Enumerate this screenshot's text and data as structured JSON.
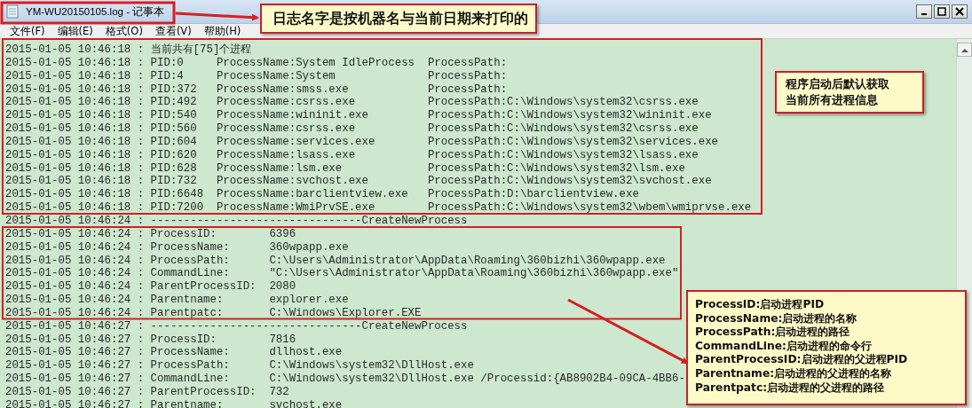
{
  "window": {
    "title": "YM-WU20150105.log - 记事本"
  },
  "menu": [
    "文件(F)",
    "编辑(E)",
    "格式(O)",
    "查看(V)",
    "帮助(H)"
  ],
  "lines": [
    {
      "kind": "note",
      "cells": [
        "2015-01-05 10:46:18 :",
        "当前共有[75]个进程"
      ]
    },
    {
      "kind": "process",
      "cells": [
        "2015-01-05 10:46:18 :",
        "PID:0",
        "ProcessName:System IdleProcess",
        "ProcessPath:"
      ]
    },
    {
      "kind": "process",
      "cells": [
        "2015-01-05 10:46:18 :",
        "PID:4",
        "ProcessName:System",
        "ProcessPath:"
      ]
    },
    {
      "kind": "process",
      "cells": [
        "2015-01-05 10:46:18 :",
        "PID:372",
        "ProcessName:smss.exe",
        "ProcessPath:"
      ]
    },
    {
      "kind": "process",
      "cells": [
        "2015-01-05 10:46:18 :",
        "PID:492",
        "ProcessName:csrss.exe",
        "ProcessPath:C:\\Windows\\system32\\csrss.exe"
      ]
    },
    {
      "kind": "process",
      "cells": [
        "2015-01-05 10:46:18 :",
        "PID:540",
        "ProcessName:wininit.exe",
        "ProcessPath:C:\\Windows\\system32\\wininit.exe"
      ]
    },
    {
      "kind": "process",
      "cells": [
        "2015-01-05 10:46:18 :",
        "PID:560",
        "ProcessName:csrss.exe",
        "ProcessPath:C:\\Windows\\system32\\csrss.exe"
      ]
    },
    {
      "kind": "process",
      "cells": [
        "2015-01-05 10:46:18 :",
        "PID:604",
        "ProcessName:services.exe",
        "ProcessPath:C:\\Windows\\system32\\services.exe"
      ]
    },
    {
      "kind": "process",
      "cells": [
        "2015-01-05 10:46:18 :",
        "PID:620",
        "ProcessName:lsass.exe",
        "ProcessPath:C:\\Windows\\system32\\lsass.exe"
      ]
    },
    {
      "kind": "process",
      "cells": [
        "2015-01-05 10:46:18 :",
        "PID:628",
        "ProcessName:lsm.exe",
        "ProcessPath:C:\\Windows\\system32\\lsm.exe"
      ]
    },
    {
      "kind": "process",
      "cells": [
        "2015-01-05 10:46:18 :",
        "PID:732",
        "ProcessName:svchost.exe",
        "ProcessPath:C:\\Windows\\system32\\svchost.exe"
      ]
    },
    {
      "kind": "process",
      "cells": [
        "2015-01-05 10:46:18 :",
        "PID:6648",
        "ProcessName:barclientview.exe",
        "ProcessPath:D:\\barclientview.exe"
      ]
    },
    {
      "kind": "process",
      "cells": [
        "2015-01-05 10:46:18 :",
        "PID:7200",
        "ProcessName:WmiPrvSE.exe",
        "ProcessPath:C:\\Windows\\system32\\wbem\\wmiprvse.exe"
      ]
    },
    {
      "kind": "separator",
      "cells": [
        "2015-01-05 10:46:24 :",
        "--------------------------------CreateNewProcess"
      ]
    },
    {
      "kind": "field",
      "cells": [
        "2015-01-05 10:46:24 :",
        "ProcessID:",
        "6396"
      ]
    },
    {
      "kind": "field",
      "cells": [
        "2015-01-05 10:46:24 :",
        "ProcessName:",
        "360wpapp.exe"
      ]
    },
    {
      "kind": "field",
      "cells": [
        "2015-01-05 10:46:24 :",
        "ProcessPath:",
        "C:\\Users\\Administrator\\AppData\\Roaming\\360bizhi\\360wpapp.exe"
      ]
    },
    {
      "kind": "field",
      "cells": [
        "2015-01-05 10:46:24 :",
        "CommandLine:",
        "\"C:\\Users\\Administrator\\AppData\\Roaming\\360bizhi\\360wpapp.exe\""
      ]
    },
    {
      "kind": "field",
      "cells": [
        "2015-01-05 10:46:24 :",
        "ParentProcessID:",
        "2080"
      ]
    },
    {
      "kind": "field",
      "cells": [
        "2015-01-05 10:46:24 :",
        "Parentname:",
        "explorer.exe"
      ]
    },
    {
      "kind": "field",
      "cells": [
        "2015-01-05 10:46:24 :",
        "Parentpatc:",
        "C:\\Windows\\Explorer.EXE"
      ]
    },
    {
      "kind": "separator",
      "cells": [
        "2015-01-05 10:46:27 :",
        "--------------------------------CreateNewProcess"
      ]
    },
    {
      "kind": "field",
      "cells": [
        "2015-01-05 10:46:27 :",
        "ProcessID:",
        "7816"
      ]
    },
    {
      "kind": "field",
      "cells": [
        "2015-01-05 10:46:27 :",
        "ProcessName:",
        "dllhost.exe"
      ]
    },
    {
      "kind": "field",
      "cells": [
        "2015-01-05 10:46:27 :",
        "ProcessPath:",
        "C:\\Windows\\system32\\DllHost.exe"
      ]
    },
    {
      "kind": "field",
      "cells": [
        "2015-01-05 10:46:27 :",
        "CommandLine:",
        "C:\\Windows\\system32\\DllHost.exe /Processid:{AB8902B4-09CA-4BB6-"
      ]
    },
    {
      "kind": "field",
      "cells": [
        "2015-01-05 10:46:27 :",
        "ParentProcessID:",
        "732"
      ]
    },
    {
      "kind": "field",
      "cells": [
        "2015-01-05 10:46:27 :",
        "Parentname:",
        "svchost.exe"
      ]
    }
  ],
  "callouts": [
    {
      "kind": "title",
      "lines": [
        "日志名字是按机器名与当前日期来打印的"
      ]
    },
    {
      "kind": "side",
      "lines": [
        "程序启动后默认获取",
        "当前所有进程信息"
      ]
    },
    {
      "kind": "legend",
      "lines": [
        "ProcessID:启动进程PID",
        "ProcessName:启动进程的名称",
        "ProcessPath:启动进程的路径",
        "CommandLine:启动进程的命令行",
        "ParentProcessID:启动进程的父进程PID",
        "Parentname:启动进程的父进程的名称",
        "Parentpatc:启动进程的父进程的路径"
      ]
    }
  ]
}
